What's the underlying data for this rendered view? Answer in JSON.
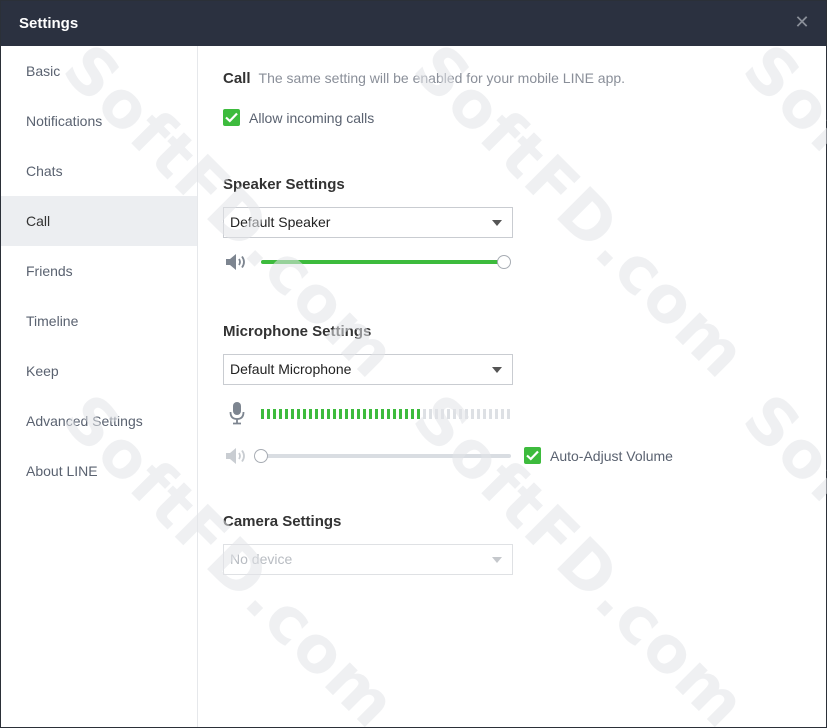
{
  "window": {
    "title": "Settings"
  },
  "sidebar": {
    "items": [
      {
        "label": "Basic"
      },
      {
        "label": "Notifications"
      },
      {
        "label": "Chats"
      },
      {
        "label": "Call",
        "active": true
      },
      {
        "label": "Friends"
      },
      {
        "label": "Timeline"
      },
      {
        "label": "Keep"
      },
      {
        "label": "Advanced Settings"
      },
      {
        "label": "About LINE"
      }
    ]
  },
  "call": {
    "heading": "Call",
    "description": "The same setting will be enabled for your mobile LINE app.",
    "allow_incoming_label": "Allow incoming calls",
    "allow_incoming_checked": true
  },
  "speaker": {
    "title": "Speaker Settings",
    "device": "Default Speaker",
    "volume_percent": 100
  },
  "microphone": {
    "title": "Microphone Settings",
    "device": "Default Microphone",
    "level_active_segments": 27,
    "level_total_segments": 42,
    "volume_percent": 0,
    "auto_adjust_label": "Auto-Adjust Volume",
    "auto_adjust_checked": true
  },
  "camera": {
    "title": "Camera Settings",
    "device_placeholder": "No device"
  },
  "watermark": "SoftFD.com",
  "colors": {
    "accent": "#3dbb3d",
    "titlebar": "#2b3140",
    "active_item": "#eceef1"
  }
}
